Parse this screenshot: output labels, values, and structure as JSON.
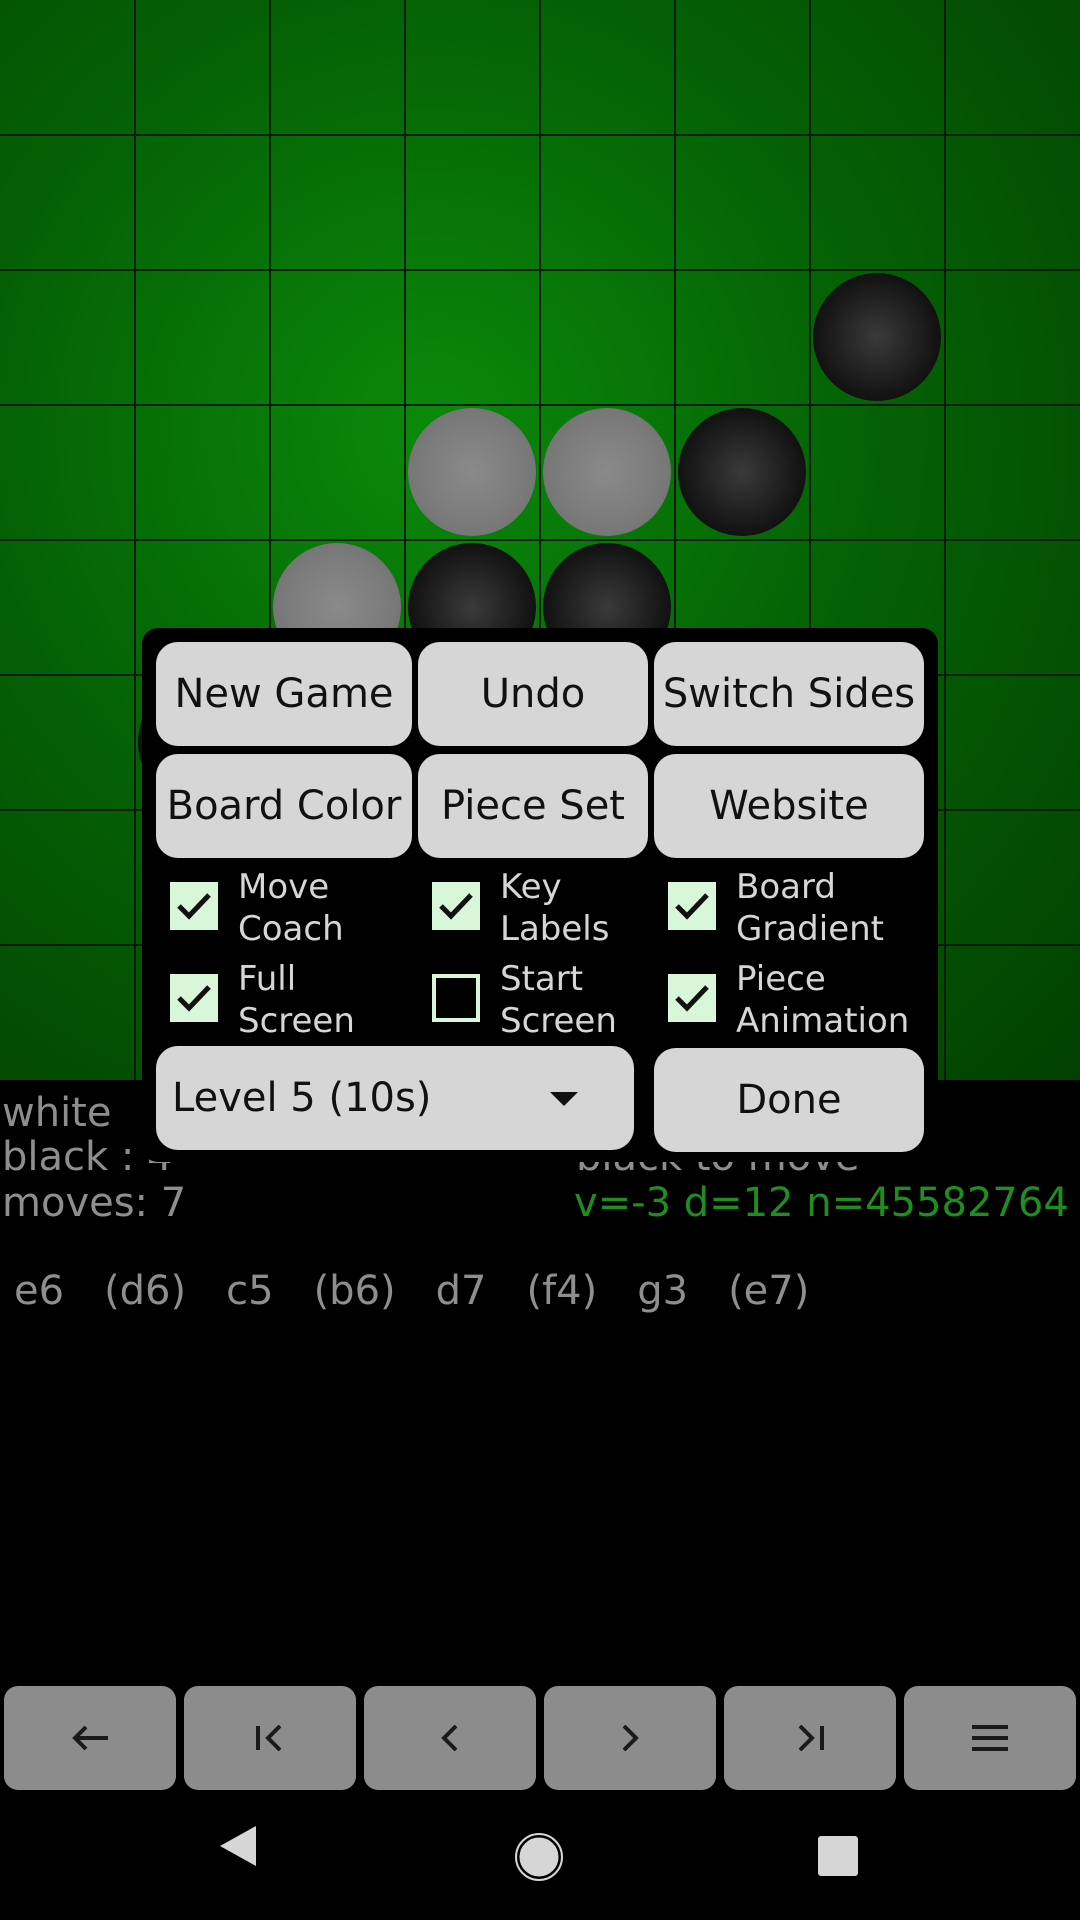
{
  "board": {
    "gradient": true,
    "pieces": [
      {
        "row": 2,
        "col": 6,
        "color": "black"
      },
      {
        "row": 3,
        "col": 3,
        "color": "white"
      },
      {
        "row": 3,
        "col": 4,
        "color": "white"
      },
      {
        "row": 3,
        "col": 5,
        "color": "black"
      },
      {
        "row": 4,
        "col": 2,
        "color": "white"
      },
      {
        "row": 4,
        "col": 3,
        "color": "black"
      },
      {
        "row": 4,
        "col": 4,
        "color": "black"
      },
      {
        "row": 5,
        "col": 1,
        "color": "black"
      }
    ]
  },
  "info": {
    "white_label": "white",
    "black_label": "black  : 4",
    "moves_label": "moves:  7",
    "turn": "black to move",
    "eval": "v=-3 d=12 n=45582764"
  },
  "move_list": [
    "e6",
    "(d6)",
    "c5",
    "(b6)",
    "d7",
    "(f4)",
    "g3",
    "(e7)"
  ],
  "dialog": {
    "buttons": {
      "new_game": "New Game",
      "undo": "Undo",
      "switch_sides": "Switch Sides",
      "board_color": "Board Color",
      "piece_set": "Piece Set",
      "website": "Website",
      "done": "Done"
    },
    "options": {
      "move_coach": {
        "line1": "Move",
        "line2": "Coach",
        "checked": true
      },
      "key_labels": {
        "line1": "Key",
        "line2": "Labels",
        "checked": true
      },
      "board_gradient": {
        "line1": "Board",
        "line2": "Gradient",
        "checked": true
      },
      "full_screen": {
        "line1": "Full",
        "line2": "Screen",
        "checked": true
      },
      "start_screen": {
        "line1": "Start",
        "line2": "Screen",
        "checked": false
      },
      "piece_animation": {
        "line1": "Piece",
        "line2": "Animation",
        "checked": true
      }
    },
    "level_select": "Level 5 (10s)"
  },
  "nav": {
    "back": "←",
    "first": "|<",
    "prev": "<",
    "next": ">",
    "last": ">|",
    "menu": "≡"
  },
  "colors": {
    "board_green": "#056305",
    "check_green": "#d8f7d8",
    "eval_green": "#1f8d1f"
  }
}
